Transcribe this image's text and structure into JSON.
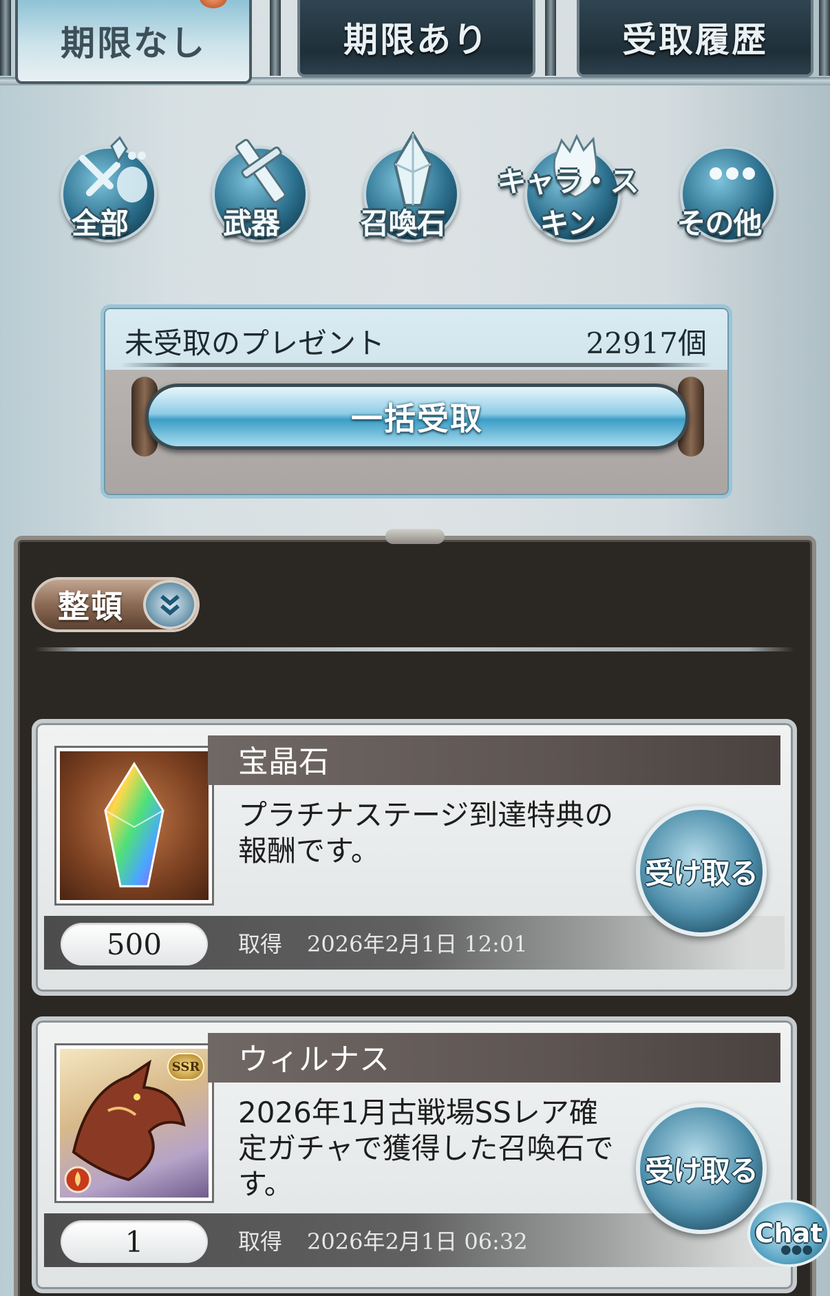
{
  "tabs": [
    {
      "label": "期限なし",
      "active": true
    },
    {
      "label": "期限あり",
      "active": false
    },
    {
      "label": "受取履歴",
      "active": false
    }
  ],
  "categories": [
    {
      "label": "全部",
      "icon": "all-items-icon"
    },
    {
      "label": "武器",
      "icon": "sword-icon"
    },
    {
      "label": "召喚石",
      "icon": "crystal-icon"
    },
    {
      "label": "キャラ・スキン",
      "icon": "character-icon"
    },
    {
      "label": "その他",
      "icon": "more-dots-icon"
    }
  ],
  "summary": {
    "title": "未受取のプレゼント",
    "count": "22917個",
    "bulk_button": "一括受取"
  },
  "list": {
    "sort_button": "整頓",
    "sort_icon": "chevron-down-double-icon"
  },
  "items": [
    {
      "name": "宝晶石",
      "description": "プラチナステージ到達特典の報酬です。",
      "quantity": "500",
      "acquired_label": "取得",
      "acquired_date": "2026年2月1日 12:01",
      "button": "受け取る",
      "thumb_icon": "rainbow-crystal-icon"
    },
    {
      "name": "ウィルナス",
      "description": "2026年1月古戦場SSレア確定ガチャで獲得した召喚石です。",
      "quantity": "1",
      "acquired_label": "取得",
      "acquired_date": "2026年2月1日 06:32",
      "button": "受け取る",
      "thumb_icon": "dragon-summon-icon",
      "rarity_badge": "SSR"
    }
  ],
  "chat": {
    "label": "Chat"
  },
  "colors": {
    "accent_blue": "#4f8fab",
    "panel_dark": "#2b2722",
    "tab_active": "#cde3ea",
    "tab_inactive": "#1f2f38"
  }
}
